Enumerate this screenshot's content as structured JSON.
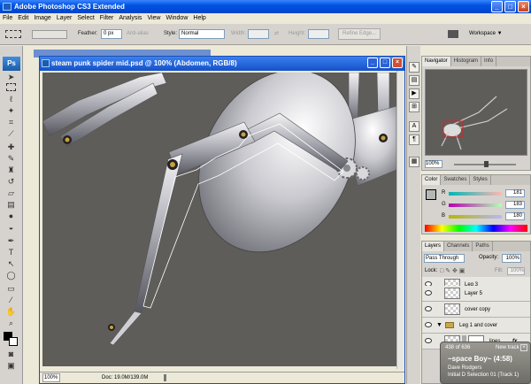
{
  "app": {
    "title": "Adobe Photoshop CS3 Extended",
    "menus": [
      "File",
      "Edit",
      "Image",
      "Layer",
      "Select",
      "Filter",
      "Analysis",
      "View",
      "Window",
      "Help"
    ]
  },
  "options": {
    "feather_label": "Feather:",
    "feather_value": "0 px",
    "antialias_label": "Anti-alias",
    "style_label": "Style:",
    "style_value": "Normal",
    "width_label": "Width:",
    "height_label": "Height:",
    "refine_label": "Refine Edge...",
    "workspace_label": "Workspace ▼"
  },
  "toolbox": {
    "logo": "Ps"
  },
  "document": {
    "title": "steam punk spider mid.psd @ 100% (Abdomen, RGB/8)",
    "zoom": "100%",
    "doc_info": "Doc: 19.0M/139.0M"
  },
  "navigator": {
    "tabs": [
      "Navigator",
      "Histogram",
      "Info"
    ],
    "zoom": "100%"
  },
  "color": {
    "tabs": [
      "Color",
      "Swatches",
      "Styles"
    ],
    "r_label": "R",
    "g_label": "G",
    "b_label": "B",
    "r": "181",
    "g": "183",
    "b": "180"
  },
  "layers": {
    "tabs": [
      "Layers",
      "Channels",
      "Paths"
    ],
    "blend_mode": "Pass Through",
    "opacity_label": "Opacity:",
    "opacity": "100%",
    "lock_label": "Lock:",
    "fill_label": "Fill:",
    "fill": "100%",
    "rows": [
      "Leg 3",
      "Layer 5",
      "cover copy",
      "Leg 1 and cover",
      "lines"
    ],
    "fx": "fx"
  },
  "media": {
    "count": "438 of 636",
    "badge": "New track",
    "song": "~space Boy~ (4:58)",
    "artist": "Dave Rodgers",
    "album": "Initial D Selection 01 (Track 1)"
  }
}
